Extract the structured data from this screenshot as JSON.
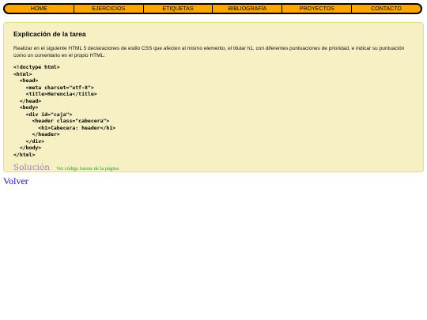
{
  "nav": {
    "items": [
      {
        "label": "HOME"
      },
      {
        "label": "EJERCICIOS"
      },
      {
        "label": "ETIQUETAS"
      },
      {
        "label": "BIBLIOGRAFÍA"
      },
      {
        "label": "PROYECTOS"
      },
      {
        "label": "CONTACTO"
      }
    ]
  },
  "task": {
    "title": "Explicación de la tarea",
    "description": "Realizar en el siguiente HTML 5 declaraciones de estilo CSS que afecten al mismo elemento, el titular h1, con diferentes puntuaciones de prioridad, e indicar su puntuación como un comentario en el propio HTML:",
    "code": "<!doctype html>\n<html>\n  <head>\n    <meta charset=\"utf-8\">\n    <title>Herencia</title>\n  </head>\n  <body>\n    <div id=\"caja\">\n      <header class=\"cabecera\">\n        <h1>Cabecera: header</h1>\n      </header>\n    </div>\n  </body>\n</html>",
    "solution_label": "Solución",
    "source_link": "Ver código fuente de la página"
  },
  "footer": {
    "back_link": "Volver"
  },
  "colors": {
    "nav_bg": "#ffa500",
    "task_bg": "#f6f0c4",
    "solution": "#9b7fc7",
    "source_link": "#22aa22",
    "back_link": "#1a0dab"
  }
}
